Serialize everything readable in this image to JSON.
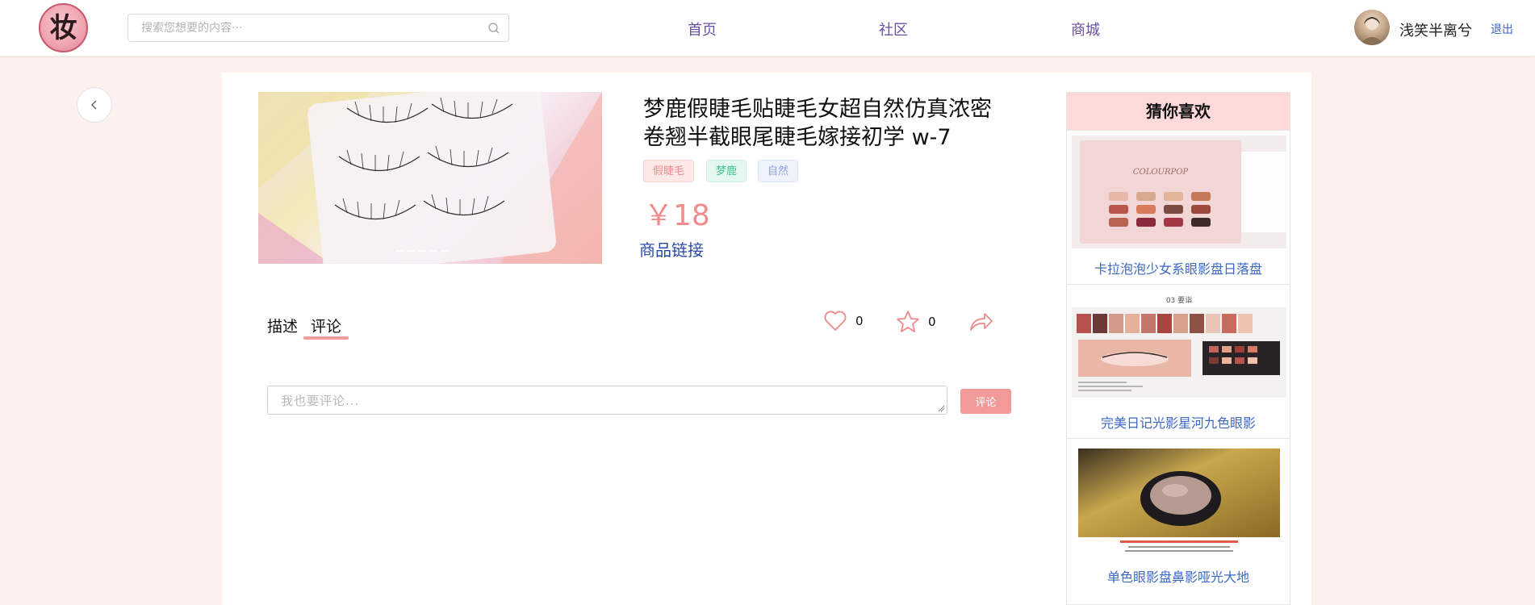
{
  "header": {
    "search_placeholder": "搜索您想要的内容···",
    "nav": [
      "首页",
      "社区",
      "商城"
    ],
    "username": "浅笑半离兮",
    "logout": "退出",
    "logo_text": "妆"
  },
  "product": {
    "title": "梦鹿假睫毛贴睫毛女超自然仿真浓密卷翘半截眼尾睫毛嫁接初学 w-7",
    "tags": [
      {
        "label": "假睫毛",
        "color": "#f08c8c",
        "bg": "#fde8e8"
      },
      {
        "label": "梦鹿",
        "color": "#3ec58f",
        "bg": "#e4f8ef"
      },
      {
        "label": "自然",
        "color": "#8ea2d9",
        "bg": "#eef3fd"
      }
    ],
    "price": "￥18",
    "link_label": "商品链接"
  },
  "tabs": [
    "描述",
    "评论"
  ],
  "active_tab": "评论",
  "actions": {
    "likes": "0",
    "favorites": "0"
  },
  "comment": {
    "placeholder": "我也要评论...",
    "button_label": "评论"
  },
  "recommend": {
    "title": "猜你喜欢",
    "items": [
      {
        "title": "卡拉泡泡少女系眼影盘日落盘",
        "image_text": "COLOURPOP"
      },
      {
        "title": "完美日记光影星河九色眼影",
        "image_text": "03 要诣"
      },
      {
        "title": "单色眼影盘鼻影哑光大地",
        "image_text": ""
      }
    ]
  },
  "colors": {
    "accent": "#f29a9a",
    "link": "#3b67c7",
    "nav": "#6a4fa0",
    "price": "#f28b8b",
    "page_bg": "#fdf1f0"
  },
  "icons": [
    "search-icon",
    "chevron-left-icon",
    "heart-icon",
    "star-icon",
    "share-icon"
  ]
}
